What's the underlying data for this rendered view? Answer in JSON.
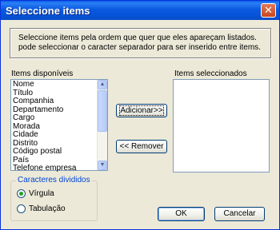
{
  "window": {
    "title": "Seleccione items"
  },
  "info": {
    "line1": "Seleccione items pela ordem que quer que eles apareçam listados.",
    "line2": "pode seleccionar o caracter separador para ser inserido entre items."
  },
  "available": {
    "label": "Items disponíveis",
    "items": [
      "Nome",
      "Título",
      "Companhia",
      "Departamento",
      "Cargo",
      "Morada",
      "Cidade",
      "Distrito",
      "Código postal",
      "País",
      "Telefone empresa"
    ]
  },
  "selected": {
    "label": "Items seleccionados",
    "items": []
  },
  "buttons": {
    "add": "Adicionar>>",
    "remove": "<< Remover",
    "ok": "OK",
    "cancel": "Cancelar"
  },
  "separator": {
    "legend": "Caracteres divididos",
    "options": [
      {
        "label": "Vírgula",
        "selected": true
      },
      {
        "label": "Tabulação",
        "selected": false
      }
    ]
  },
  "colors": {
    "titlebar": "#0a5ae0",
    "dialog_bg": "#ece9d8",
    "accent": "#0046d5"
  }
}
